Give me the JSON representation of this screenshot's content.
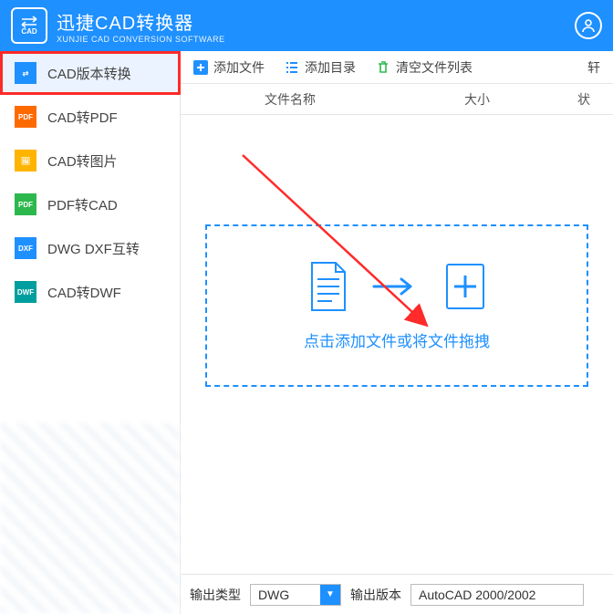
{
  "header": {
    "logo_text": "CAD",
    "title": "迅捷CAD转换器",
    "subtitle": "XUNJIE CAD CONVERSION SOFTWARE"
  },
  "sidebar": {
    "items": [
      {
        "label": "CAD版本转换",
        "icon_bg": "#1e90ff"
      },
      {
        "label": "CAD转PDF",
        "icon_bg": "#ff6a00"
      },
      {
        "label": "CAD转图片",
        "icon_bg": "#ffb400"
      },
      {
        "label": "PDF转CAD",
        "icon_bg": "#2db84d"
      },
      {
        "label": "DWG DXF互转",
        "icon_bg": "#1e90ff"
      },
      {
        "label": "CAD转DWF",
        "icon_bg": "#009e9e"
      }
    ]
  },
  "toolbar": {
    "add_file": "添加文件",
    "add_dir": "添加目录",
    "clear": "清空文件列表",
    "trail_char": "轩"
  },
  "table": {
    "col_name": "文件名称",
    "col_size": "大小",
    "col_status": "状"
  },
  "drop": {
    "text": "点击添加文件或将文件拖拽"
  },
  "output": {
    "type_label": "输出类型",
    "type_value": "DWG",
    "ver_label": "输出版本",
    "ver_value": "AutoCAD 2000/2002"
  }
}
